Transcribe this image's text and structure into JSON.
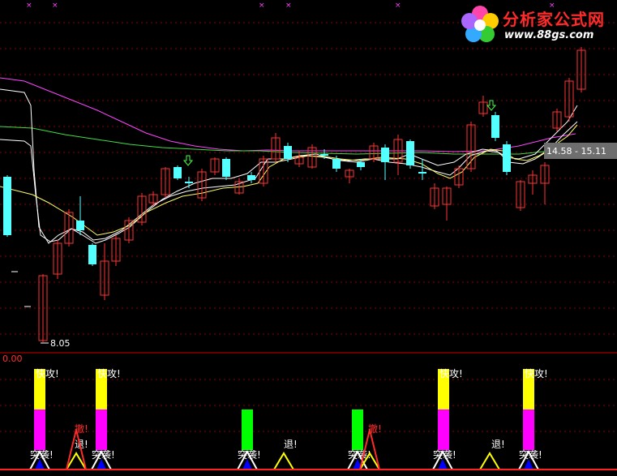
{
  "watermark": {
    "title": "分析家公式网",
    "url": "www.88gs.com"
  },
  "colors": {
    "background": "#000000",
    "grid": "#8b0000",
    "up_candle": "#ff3333",
    "down_candle": "#54ffff",
    "ma_white": "#ffffff",
    "ma_yellow": "#ffff66",
    "ma_magenta": "#ff44ff",
    "ma_green": "#44dd44",
    "signal_yellow": "#ffff00",
    "signal_magenta": "#ff00ff",
    "signal_green": "#00ff00",
    "signal_blue": "#0000ff",
    "label_white": "#ffffff",
    "label_red": "#ff2a2a",
    "indicator_zero": "#ff3333"
  },
  "price_panel": {
    "low_label": "8.05",
    "price_label": "14.58 - 15.11",
    "top_marks": "×"
  },
  "indicator_panel": {
    "zero_label": "0.00",
    "signal_labels": {
      "attack": "快攻!",
      "raid": "突袭!",
      "retreat": "退!",
      "withdraw": "撤!"
    }
  },
  "chart_data": {
    "type": "candlestick",
    "low_value": 8.05,
    "last_range": [
      14.58,
      15.11
    ],
    "indicator_zero": 0.0
  }
}
